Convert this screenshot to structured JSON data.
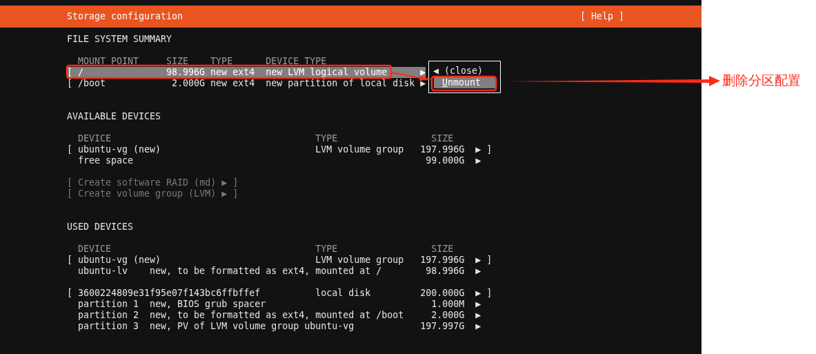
{
  "header": {
    "title": "Storage configuration",
    "help": "[ Help ]"
  },
  "filesystem_summary": {
    "title": "FILE SYSTEM SUMMARY",
    "columns": [
      "MOUNT POINT",
      "SIZE",
      "TYPE",
      "DEVICE TYPE"
    ],
    "rows": [
      {
        "bracket": "[",
        "mount_point": "/",
        "size": "98.996G",
        "type": "new ext4",
        "device_type": "new LVM logical volume",
        "arrow": "▶",
        "selected": true
      },
      {
        "bracket": "[",
        "mount_point": "/boot",
        "size": "2.000G",
        "type": "new ext4",
        "device_type": "new partition of local disk",
        "arrow": "▶",
        "selected": false
      }
    ]
  },
  "action_menu": {
    "items": [
      {
        "label": "◀ (close)",
        "selected": false
      },
      {
        "label": "Unmount",
        "selected": true
      }
    ]
  },
  "available_devices": {
    "title": "AVAILABLE DEVICES",
    "columns": [
      "DEVICE",
      "TYPE",
      "SIZE"
    ],
    "groups": [
      {
        "rows": [
          {
            "bracket": "[",
            "device": "ubuntu-vg (new)",
            "type": "LVM volume group",
            "size": "197.996G",
            "arrow": "▶",
            "close": "]"
          },
          {
            "device": "free space",
            "size": "99.000G",
            "arrow": "▶"
          }
        ]
      }
    ],
    "actions": [
      {
        "label": "[ Create software RAID (md) ▶ ]",
        "disabled": true
      },
      {
        "label": "[ Create volume group (LVM) ▶ ]",
        "disabled": true
      }
    ]
  },
  "used_devices": {
    "title": "USED DEVICES",
    "columns": [
      "DEVICE",
      "TYPE",
      "SIZE"
    ],
    "groups": [
      {
        "rows": [
          {
            "bracket": "[",
            "device": "ubuntu-vg (new)",
            "type": "LVM volume group",
            "size": "197.996G",
            "arrow": "▶",
            "close": "]"
          },
          {
            "device": "ubuntu-lv",
            "description": "new, to be formatted as ext4, mounted at /",
            "size": "98.996G",
            "arrow": "▶"
          }
        ]
      },
      {
        "rows": [
          {
            "bracket": "[",
            "device": "3600224809e31f95e07f143bc6ffbffef",
            "type": "local disk",
            "size": "200.000G",
            "arrow": "▶",
            "close": "]"
          },
          {
            "device": "partition 1",
            "description": "new, BIOS grub spacer",
            "size": "1.000M",
            "arrow": "▶"
          },
          {
            "device": "partition 2",
            "description": "new, to be formatted as ext4, mounted at /boot",
            "size": "2.000G",
            "arrow": "▶"
          },
          {
            "device": "partition 3",
            "description": "new, PV of LVM volume group ubuntu-vg",
            "size": "197.997G",
            "arrow": "▶"
          }
        ]
      }
    ]
  },
  "annotation": {
    "label": "删除分区配置"
  }
}
